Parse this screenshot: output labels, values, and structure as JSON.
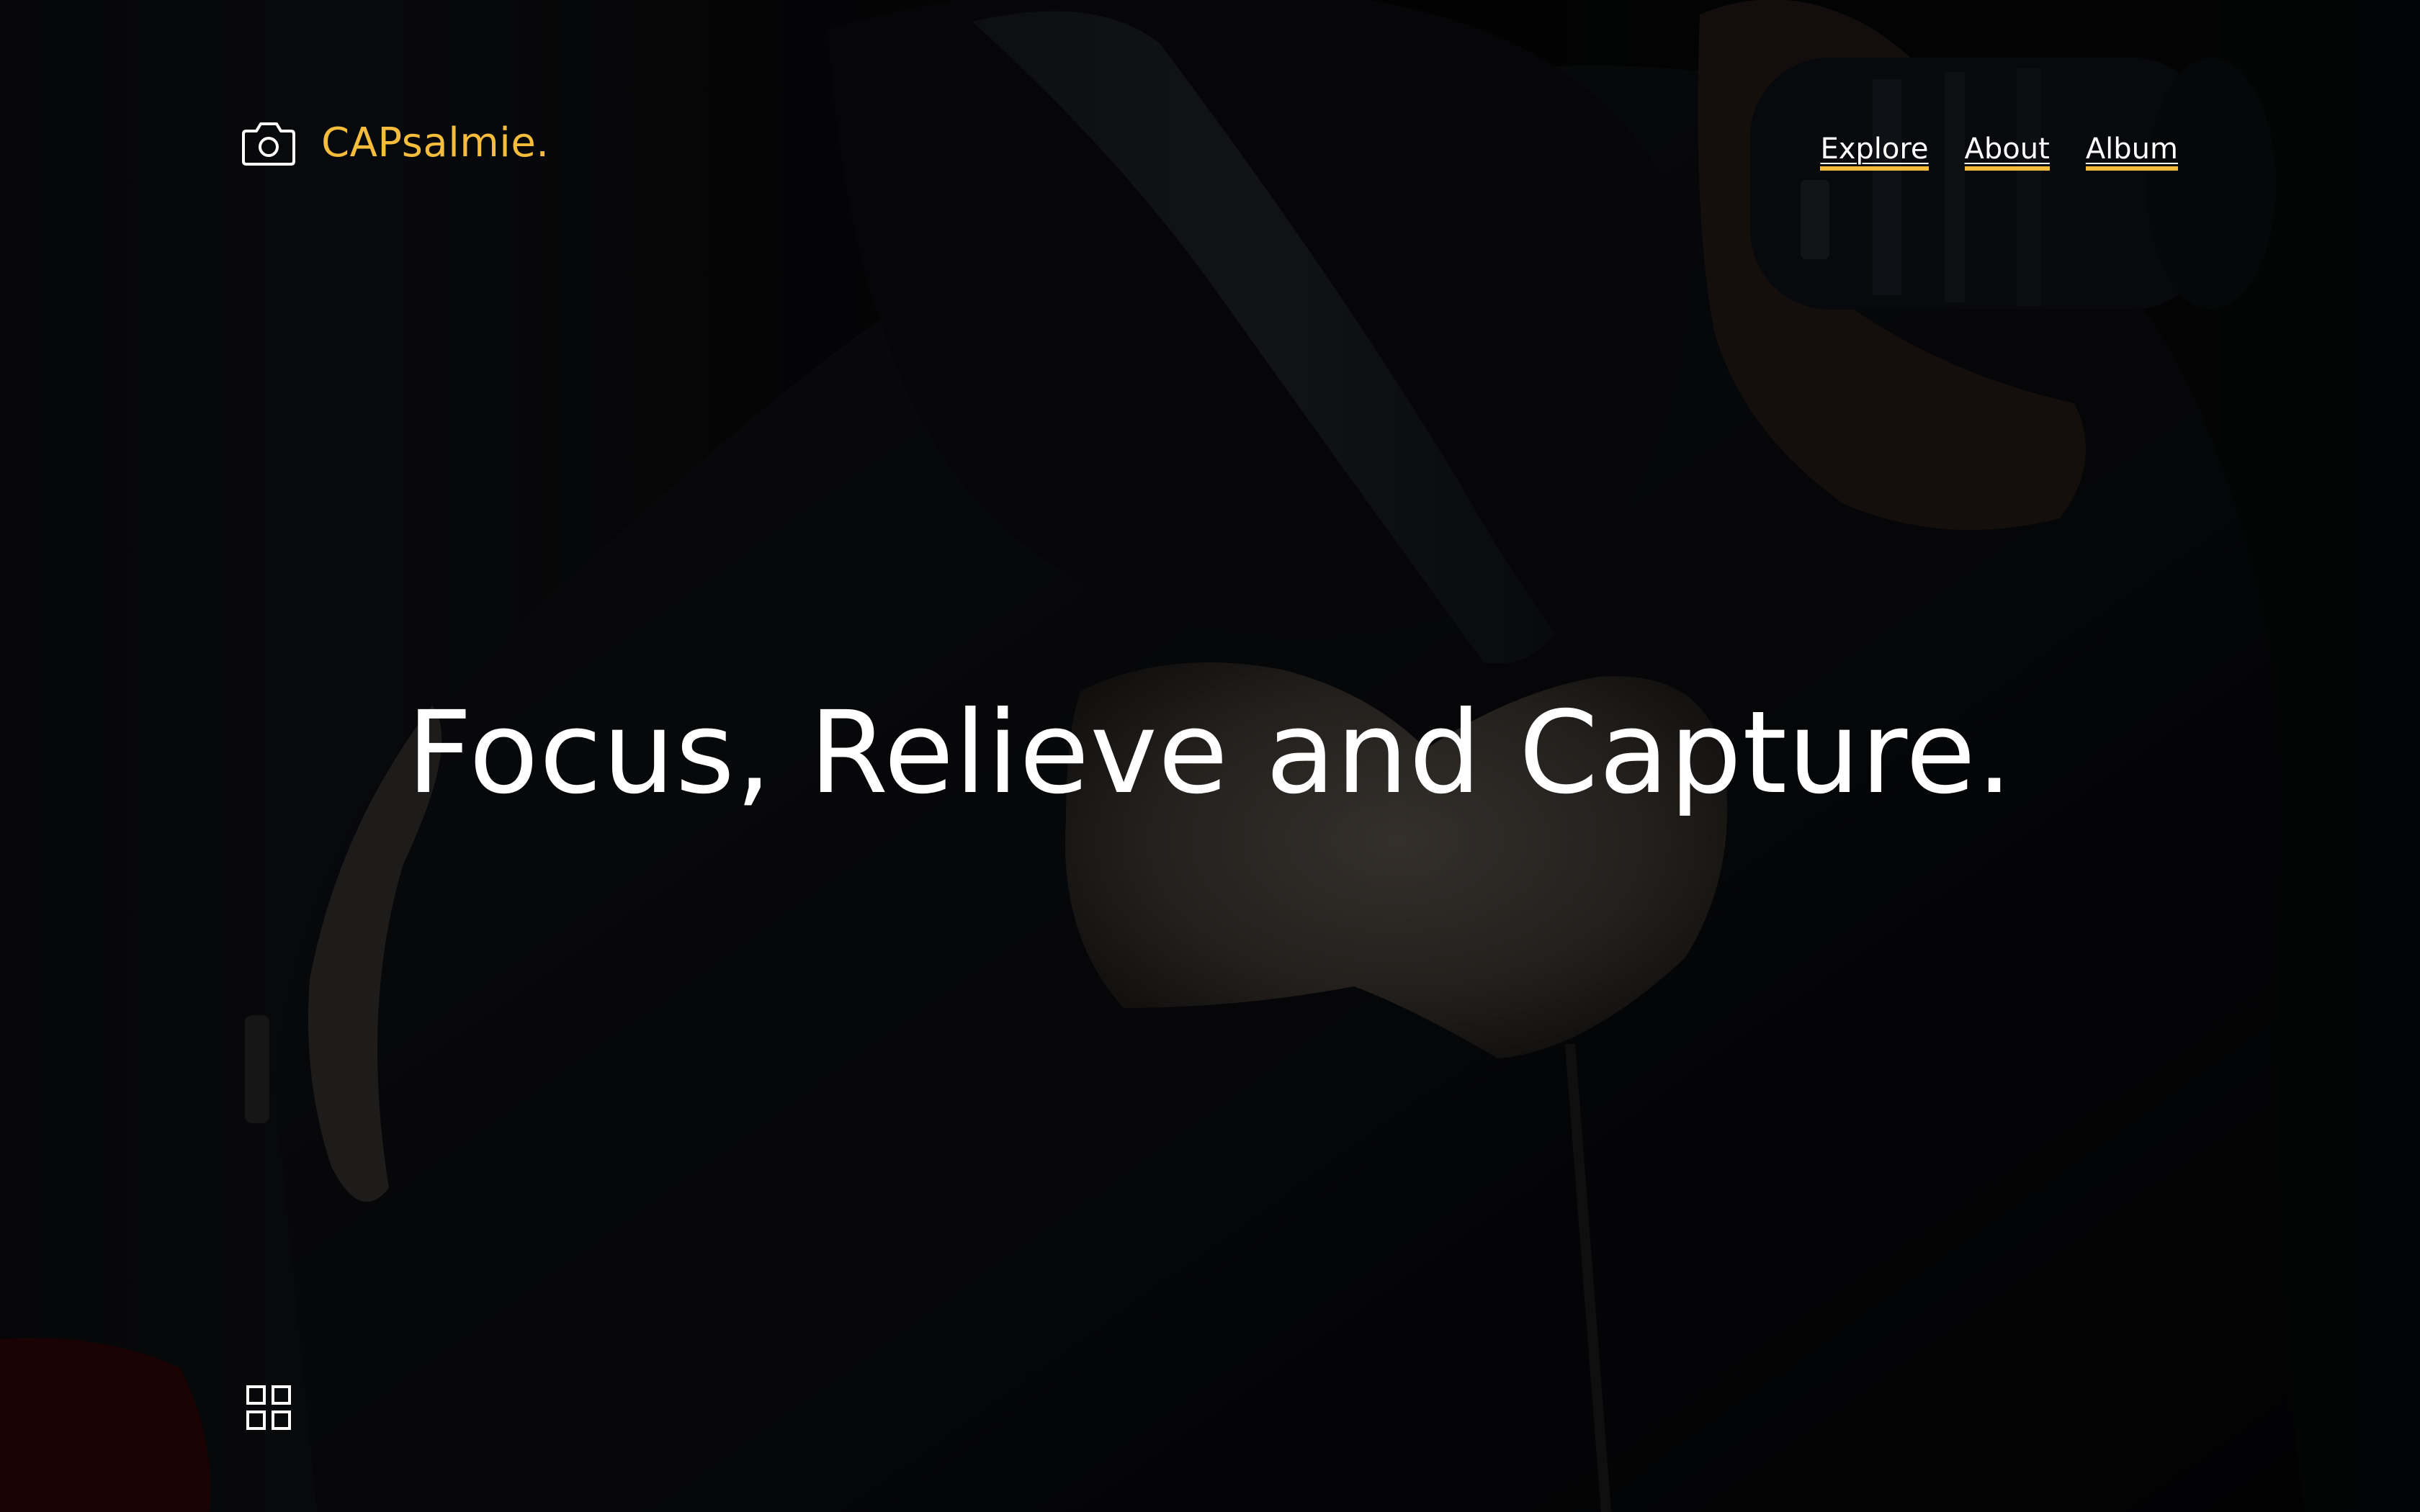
{
  "brand": {
    "name": "CAPsalmie.",
    "icon": "camera-icon"
  },
  "nav": {
    "items": [
      {
        "label": "Explore"
      },
      {
        "label": "About"
      },
      {
        "label": "Album"
      }
    ]
  },
  "hero": {
    "headline": "Focus, Relieve and Capture."
  },
  "controls": {
    "grid_icon": "grid-icon"
  },
  "colors": {
    "accent": "#f5bd3b",
    "text": "#ffffff",
    "background": "#050506"
  }
}
